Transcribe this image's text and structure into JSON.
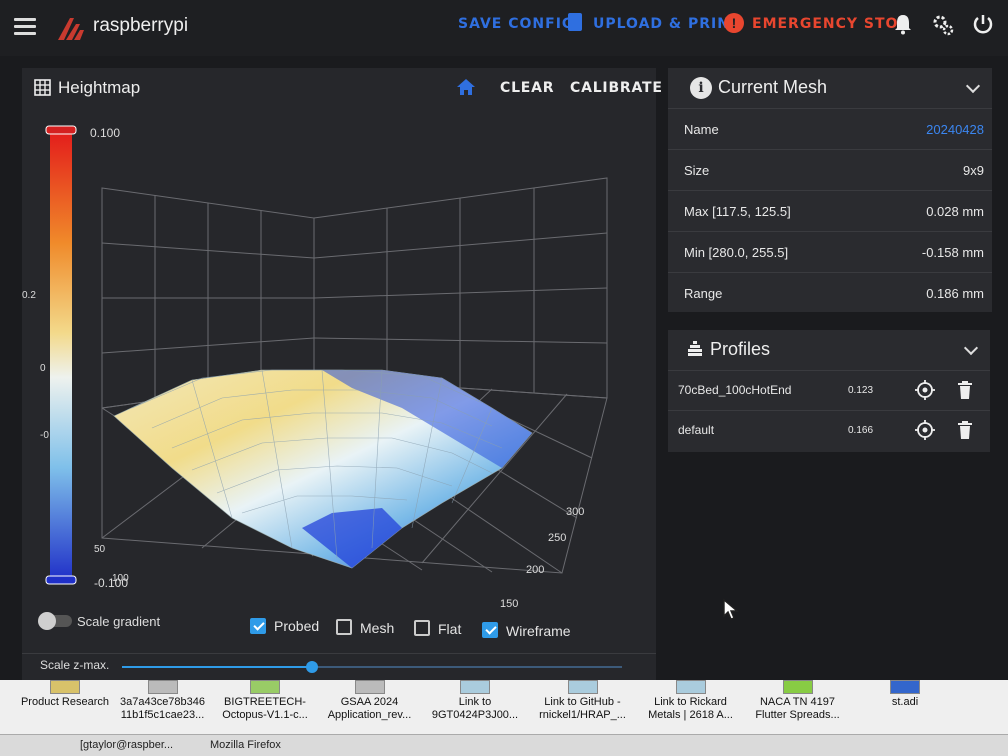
{
  "app": {
    "brand": "raspberrypi",
    "actions": {
      "save_config": "SAVE CONFIG",
      "upload_print": "UPLOAD & PRINT",
      "emergency_stop": "EMERGENCY STOP"
    }
  },
  "heightmap": {
    "title": "Heightmap",
    "clear": "CLEAR",
    "calibrate": "CALIBRATE",
    "scale": {
      "max": "0.100",
      "min": "-0.100"
    },
    "axis_ticks_right": [
      "300",
      "250",
      "200",
      "150"
    ],
    "axis_ticks_left": [
      "50",
      "100"
    ],
    "z_ticks_left": [
      "0.2",
      "0",
      "-0"
    ],
    "controls": {
      "scale_gradient": "Scale gradient",
      "probed": {
        "label": "Probed",
        "checked": true
      },
      "mesh": {
        "label": "Mesh",
        "checked": false
      },
      "flat": {
        "label": "Flat",
        "checked": false
      },
      "wireframe": {
        "label": "Wireframe",
        "checked": true
      }
    },
    "scale_zmax_label": "Scale z-max.",
    "scale_zmax_value": 0.38
  },
  "current_mesh": {
    "title": "Current Mesh",
    "rows": [
      {
        "key": "Name",
        "value": "20240428",
        "link": true
      },
      {
        "key": "Size",
        "value": "9x9",
        "link": false
      },
      {
        "key": "Max [117.5, 125.5]",
        "value": "0.028 mm",
        "link": false
      },
      {
        "key": "Min [280.0, 255.5]",
        "value": "-0.158 mm",
        "link": false
      },
      {
        "key": "Range",
        "value": "0.186 mm",
        "link": false
      }
    ]
  },
  "profiles": {
    "title": "Profiles",
    "items": [
      {
        "name": "70cBed_100cHotEnd",
        "variance": "0.123"
      },
      {
        "name": "default",
        "variance": "0.166"
      }
    ]
  },
  "desktop": {
    "items": [
      {
        "label": "Product Research"
      },
      {
        "label": "3a7a43ce78b346 11b1f5c1cae23..."
      },
      {
        "label": "BIGTREETECH- Octopus-V1.1-c..."
      },
      {
        "label": "GSAA 2024 Application_rev..."
      },
      {
        "label": "Link to 9GT0424P3J00..."
      },
      {
        "label": "Link to GitHub - rnickel1/HRAP_..."
      },
      {
        "label": "Link to Rickard Metals | 2618 A..."
      },
      {
        "label": "NACA TN 4197 Flutter Spreads..."
      },
      {
        "label": "st.adi"
      }
    ],
    "taskbar": [
      "[gtaylor@raspber...",
      "Mozilla Firefox"
    ]
  },
  "colors": {
    "accent_blue": "#2f6fe0",
    "danger": "#e8462f",
    "link": "#3b86f0"
  }
}
